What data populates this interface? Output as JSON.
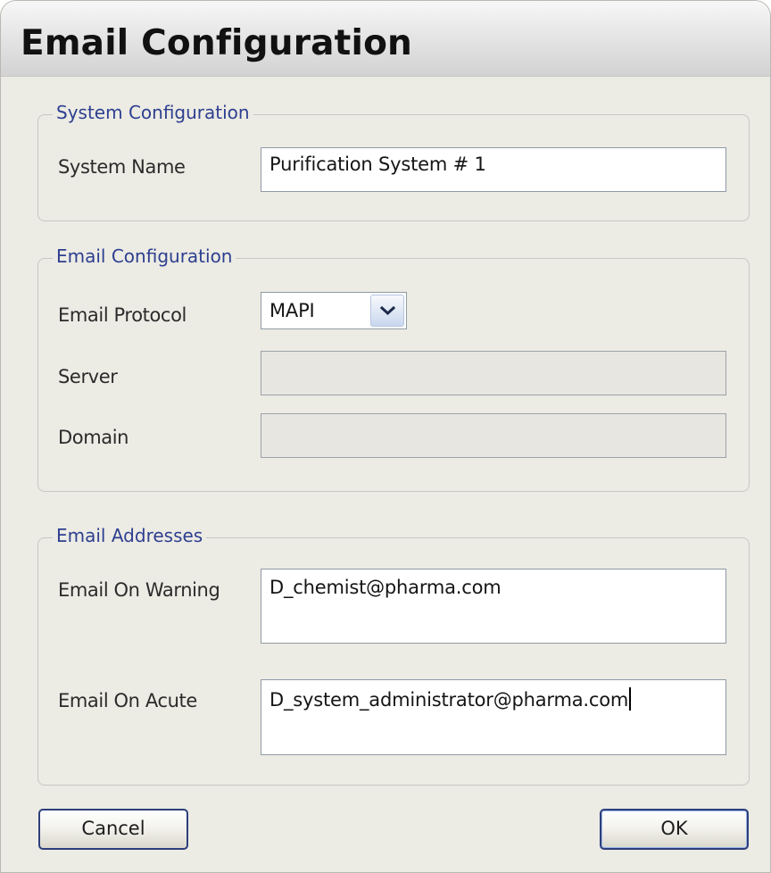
{
  "window": {
    "title": "Email Configuration"
  },
  "system_configuration": {
    "legend": "System Configuration",
    "system_name_label": "System Name",
    "system_name_value": "Purification System # 1"
  },
  "email_configuration": {
    "legend": "Email Configuration",
    "protocol_label": "Email Protocol",
    "protocol_value": "MAPI",
    "server_label": "Server",
    "server_value": "",
    "domain_label": "Domain",
    "domain_value": ""
  },
  "email_addresses": {
    "legend": "Email Addresses",
    "warning_label": "Email On Warning",
    "warning_value": "D_chemist@pharma.com",
    "acute_label": "Email On Acute",
    "acute_value": "D_system_administrator@pharma.com"
  },
  "buttons": {
    "cancel": "Cancel",
    "ok": "OK"
  },
  "icons": {
    "dropdown": "chevron-down-icon"
  }
}
